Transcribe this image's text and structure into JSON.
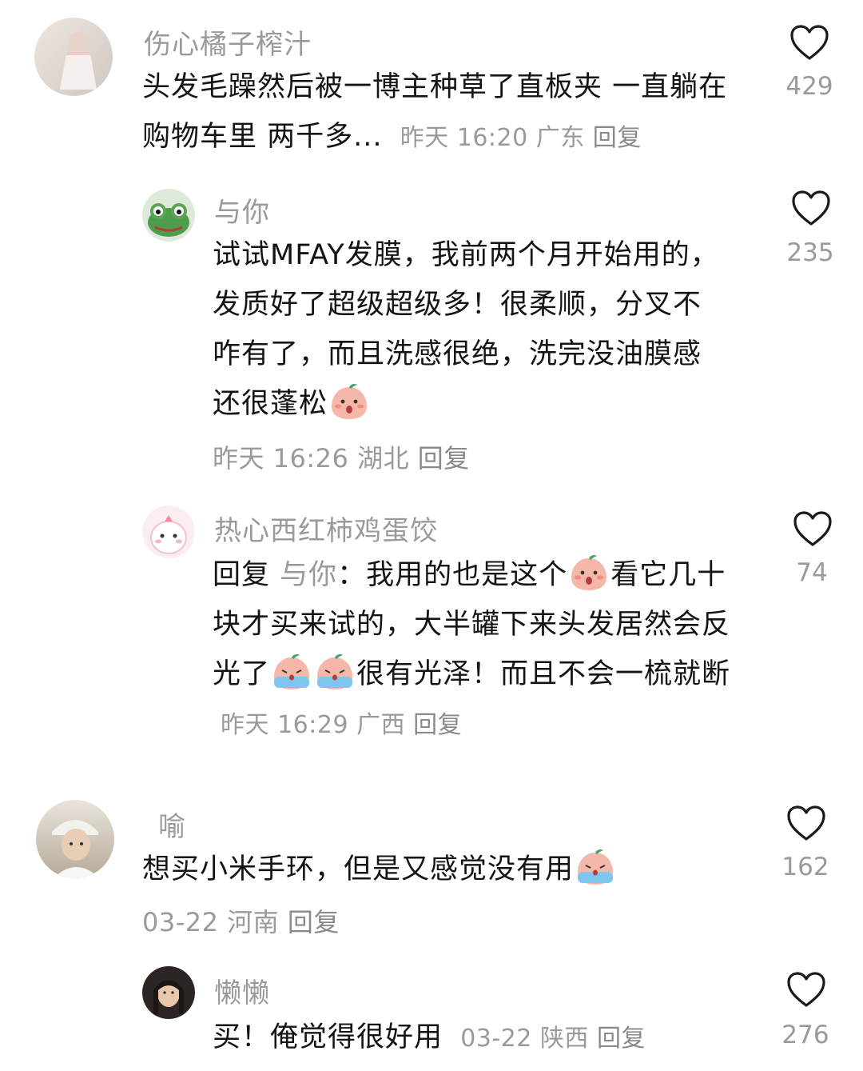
{
  "comments": [
    {
      "username": "伤心橘子榨汁",
      "text": "头发毛躁然后被一博主种草了直板夹 一直躺在购物车里 两千多...",
      "time": "昨天 16:20",
      "location": "广东",
      "reply_label": "回复",
      "likes": "429"
    },
    {
      "username": "与你",
      "text": "试试MFAY发膜，我前两个月开始用的，发质好了超级超级多！很柔顺，分叉不咋有了，而且洗感很绝，洗完没油膜感还很蓬松",
      "time": "昨天 16:26",
      "location": "湖北",
      "reply_label": "回复",
      "likes": "235"
    },
    {
      "username": "热心西红柿鸡蛋饺",
      "reply_prefix": "回复",
      "reply_to": "与你",
      "text_a": "：我用的也是这个",
      "text_b": "看它几十块才买来试的，大半罐下来头发居然会反光了",
      "text_c": "很有光泽！而且不会一梳就断",
      "time": "昨天 16:29",
      "location": "广西",
      "reply_label": "回复",
      "likes": "74"
    },
    {
      "username": "喻",
      "text": "想买小米手环，但是又感觉没有用",
      "time": "03-22",
      "location": "河南",
      "reply_label": "回复",
      "likes": "162"
    },
    {
      "username": "懒懒",
      "text": "买！俺觉得很好用",
      "time": "03-22",
      "location": "陕西",
      "reply_label": "回复",
      "likes": "276"
    }
  ],
  "colors": {
    "meta": "#9a9a9a",
    "text": "#141414",
    "emoji_peach": "#f6b7ab"
  },
  "icons": [
    "heart-outline-icon",
    "shocked-peach-emoji",
    "covering-mouth-peach-emoji",
    "crying-peach-emoji"
  ]
}
